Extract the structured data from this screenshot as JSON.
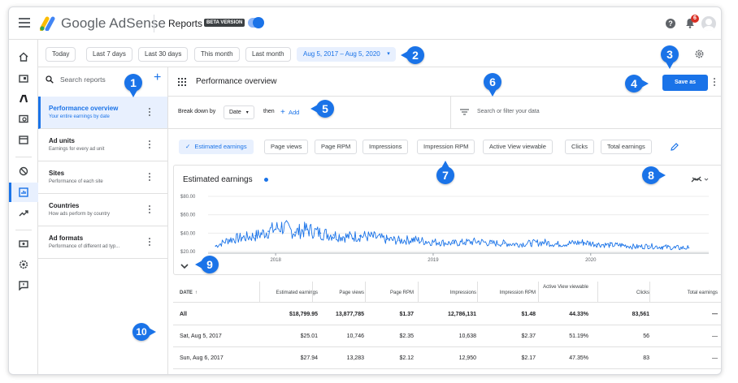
{
  "topbar": {
    "product_name": "Google AdSense",
    "section_title": "Reports",
    "beta_label": "BETA VERSION",
    "notification_count": "6"
  },
  "date_range": {
    "presets": [
      "Today",
      "Last 7 days",
      "Last 30 days",
      "This month",
      "Last month"
    ],
    "selected": "Aug 5, 2017 – Aug 5, 2020"
  },
  "saved_reports": {
    "search_placeholder": "Search reports",
    "items": [
      {
        "title": "Performance overview",
        "subtitle": "Your entire earnings by date"
      },
      {
        "title": "Ad units",
        "subtitle": "Earnings for every ad unit"
      },
      {
        "title": "Sites",
        "subtitle": "Performance of each site"
      },
      {
        "title": "Countries",
        "subtitle": "How ads perform by country"
      },
      {
        "title": "Ad formats",
        "subtitle": "Performance of different ad typ..."
      }
    ]
  },
  "report": {
    "title": "Performance overview",
    "save_label": "Save as",
    "breakdown_label": "Break down by",
    "breakdown_value": "Date",
    "then_label": "then",
    "add_label": "Add",
    "filter_placeholder": "Search or filter your data"
  },
  "metrics": [
    {
      "label": "Estimated earnings",
      "selected": true
    },
    {
      "label": "Page views",
      "selected": false
    },
    {
      "label": "Page RPM",
      "selected": false
    },
    {
      "label": "Impressions",
      "selected": false
    },
    {
      "label": "Impression RPM",
      "selected": false
    },
    {
      "label": "Active View viewable",
      "selected": false
    },
    {
      "label": "Clicks",
      "selected": false
    },
    {
      "label": "Total earnings",
      "selected": false
    }
  ],
  "chart_data": {
    "type": "line",
    "title": "Estimated earnings",
    "xlabel": "",
    "ylabel": "",
    "ylim": [
      20,
      80
    ],
    "y_ticks": [
      "$80.00",
      "$60.00",
      "$40.00",
      "$20.00"
    ],
    "x_ticks": [
      "2018",
      "2019",
      "2020"
    ],
    "xlim": [
      "2017-08-05",
      "2020-08-05"
    ],
    "series": [
      {
        "color": "#1a73e8",
        "x": [
          "2017-08",
          "2017-09",
          "2017-10",
          "2017-11",
          "2017-12",
          "2018-01",
          "2018-02",
          "2018-03",
          "2018-04",
          "2018-05",
          "2018-06",
          "2018-07",
          "2018-08",
          "2018-09",
          "2018-10",
          "2018-11",
          "2018-12",
          "2019-01",
          "2019-02",
          "2019-03",
          "2019-04",
          "2019-05",
          "2019-06",
          "2019-07",
          "2019-08",
          "2019-09",
          "2019-10",
          "2019-11",
          "2019-12",
          "2020-01",
          "2020-02",
          "2020-03",
          "2020-04",
          "2020-05",
          "2020-06",
          "2020-07",
          "2020-08"
        ],
        "values": [
          26,
          33,
          35,
          37,
          42,
          47,
          41,
          44,
          40,
          38,
          36,
          37,
          36,
          33,
          32,
          33,
          31,
          30,
          29,
          30,
          31,
          29,
          29,
          28,
          29,
          30,
          28,
          29,
          30,
          28,
          27,
          27,
          25,
          26,
          25,
          24,
          24
        ]
      }
    ],
    "grid": true
  },
  "table": {
    "columns": [
      "DATE",
      "Estimated earnings",
      "Page views",
      "Page RPM",
      "Impressions",
      "Impression RPM",
      "Active View viewable",
      "Clicks",
      "Total earnings"
    ],
    "sort_indicator": "↑",
    "rows": [
      [
        "All",
        "$18,799.95",
        "13,877,785",
        "$1.37",
        "12,786,131",
        "$1.48",
        "44.33%",
        "83,561",
        "—"
      ],
      [
        "Sat, Aug 5, 2017",
        "$25.01",
        "10,746",
        "$2.35",
        "10,638",
        "$2.37",
        "51.19%",
        "56",
        "—"
      ],
      [
        "Sun, Aug 6, 2017",
        "$27.94",
        "13,283",
        "$2.12",
        "12,950",
        "$2.17",
        "47.35%",
        "83",
        "—"
      ]
    ]
  },
  "callouts": [
    "1",
    "2",
    "3",
    "4",
    "5",
    "6",
    "7",
    "8",
    "9",
    "10"
  ],
  "colors": {
    "accent": "#1a73e8",
    "selected_bg": "#e8f0fe",
    "border": "#e0e0e0",
    "badge": "#d93025"
  }
}
